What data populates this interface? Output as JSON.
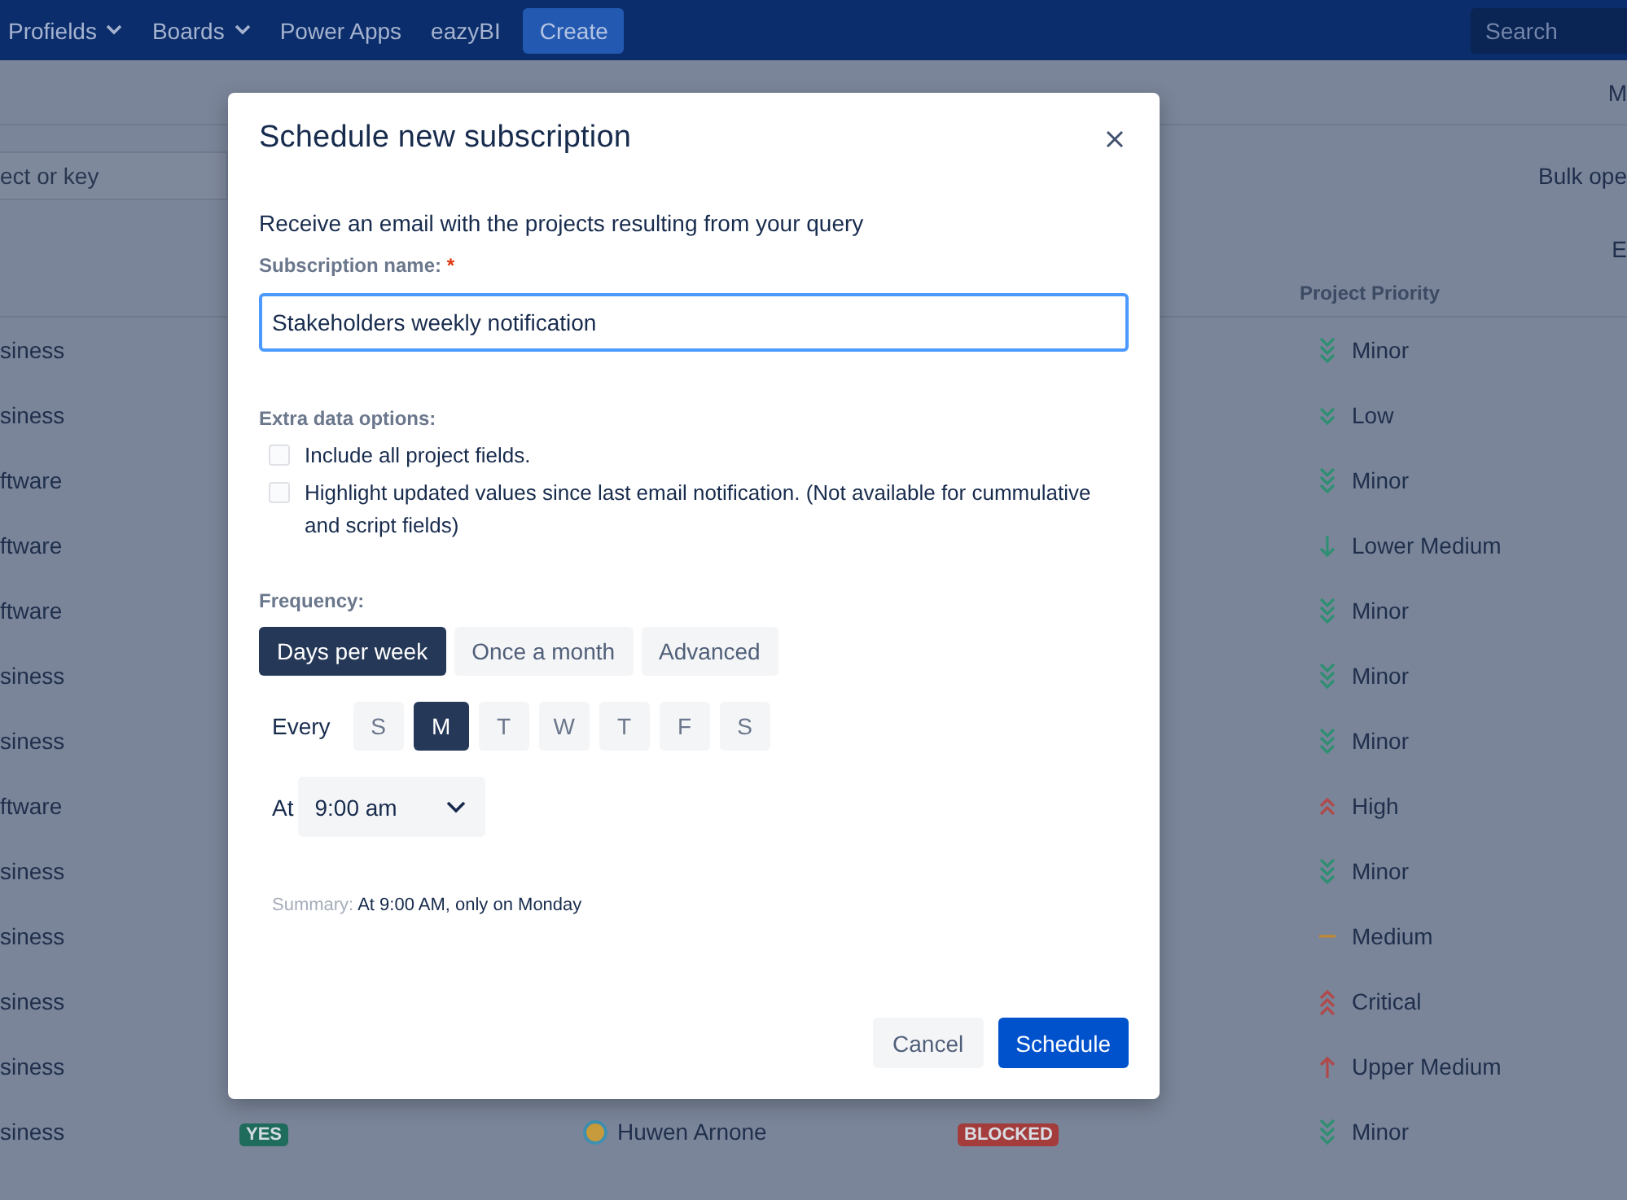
{
  "top_nav": {
    "items": [
      {
        "label": "Profields",
        "dropdown": true
      },
      {
        "label": "Boards",
        "dropdown": true
      },
      {
        "label": "Power Apps",
        "dropdown": false
      },
      {
        "label": "eazyBI",
        "dropdown": false
      }
    ],
    "create_button": "Create",
    "search": {
      "placeholder": "Search"
    }
  },
  "page": {
    "header_text": "M",
    "search": {
      "placeholder": "ect or key"
    },
    "bulk_action": "Bulk ope",
    "column_text": "E",
    "table": {
      "columns": [
        "Project Priority"
      ],
      "rows": [
        {
          "column_1": "siness",
          "priority": {
            "label": "Minor",
            "kind": "minor"
          }
        },
        {
          "column_1": "siness",
          "priority": {
            "label": "Low",
            "kind": "low"
          }
        },
        {
          "column_1": "ftware",
          "priority": {
            "label": "Minor",
            "kind": "minor"
          }
        },
        {
          "column_1": "ftware",
          "priority": {
            "label": "Lower Medium",
            "kind": "lower-medium"
          }
        },
        {
          "column_1": "ftware",
          "priority": {
            "label": "Minor",
            "kind": "minor"
          }
        },
        {
          "column_1": "siness",
          "priority": {
            "label": "Minor",
            "kind": "minor"
          }
        },
        {
          "column_1": "siness",
          "priority": {
            "label": "Minor",
            "kind": "minor"
          }
        },
        {
          "column_1": "ftware",
          "priority": {
            "label": "High",
            "kind": "high"
          }
        },
        {
          "column_1": "siness",
          "priority": {
            "label": "Minor",
            "kind": "minor"
          }
        },
        {
          "column_1": "siness",
          "priority": {
            "label": "Medium",
            "kind": "medium"
          }
        },
        {
          "column_1": "siness",
          "priority": {
            "label": "Critical",
            "kind": "critical"
          }
        },
        {
          "column_1": "siness",
          "priority": {
            "label": "Upper Medium",
            "kind": "upper-medium"
          }
        },
        {
          "column_1": "siness",
          "badge": "YES",
          "assignee": "Huwen Arnone",
          "status": {
            "label": "BLOCKED",
            "color": "#a43c3c"
          },
          "priority": {
            "label": "Minor",
            "kind": "minor"
          }
        }
      ]
    }
  },
  "modal": {
    "title": "Schedule new subscription",
    "description": "Receive an email with the projects resulting from your query",
    "name_field": {
      "label": "Subscription name:",
      "required_mark": "*",
      "value": "Stakeholders weekly notification",
      "focused": true
    },
    "extra_label": "Extra data options:",
    "extra_options": [
      {
        "label": "Include all project fields.",
        "checked": false
      },
      {
        "label": "Highlight updated values since last email notification. (Not available for cummulative and script fields)",
        "checked": false
      }
    ],
    "frequency_label": "Frequency:",
    "frequency_options": [
      {
        "label": "Days per week",
        "selected": true
      },
      {
        "label": "Once a month",
        "selected": false
      },
      {
        "label": "Advanced",
        "selected": false
      }
    ],
    "every_label": "Every",
    "days": [
      {
        "label": "S",
        "selected": false
      },
      {
        "label": "M",
        "selected": true
      },
      {
        "label": "T",
        "selected": false
      },
      {
        "label": "W",
        "selected": false
      },
      {
        "label": "T",
        "selected": false
      },
      {
        "label": "F",
        "selected": false
      },
      {
        "label": "S",
        "selected": false
      }
    ],
    "at_label": "At",
    "time": "9:00 am",
    "summary_label": "Summary:",
    "summary": "At 9:00 AM, only on Monday",
    "buttons": [
      {
        "label": "Cancel",
        "kind": "secondary"
      },
      {
        "label": "Schedule",
        "kind": "primary"
      }
    ]
  }
}
